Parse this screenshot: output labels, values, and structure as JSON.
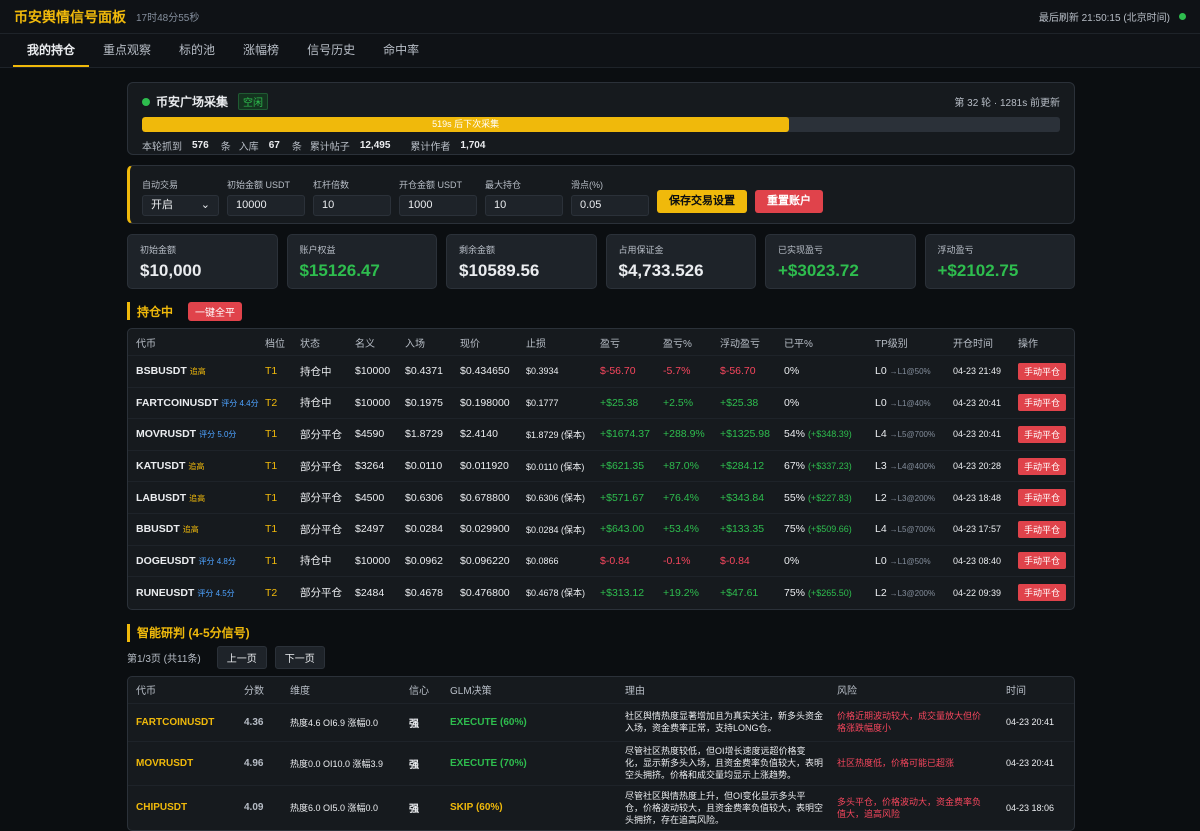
{
  "header": {
    "title": "币安舆情信号面板",
    "uptime": "17时48分55秒",
    "last_refresh": "最后刷新 21:50:15 (北京时间)"
  },
  "nav": {
    "tabs": [
      "我的持仓",
      "重点观察",
      "标的池",
      "涨幅榜",
      "信号历史",
      "命中率"
    ],
    "active": "我的持仓"
  },
  "collector": {
    "title": "币安广场采集",
    "status": "空闲",
    "round_info": "第 32 轮 · 1281s 前更新",
    "progress_text": "519s 后下次采集",
    "progress_fraction": 0.705,
    "stats": [
      {
        "label": "本轮抓到",
        "value": "576",
        "unit": "条"
      },
      {
        "label": "入库",
        "value": "67",
        "unit": "条"
      },
      {
        "label": "累计帖子",
        "value": "12,495",
        "unit": ""
      },
      {
        "label": "累计作者",
        "value": "1,704",
        "unit": ""
      }
    ]
  },
  "settings": {
    "auto_trade_label": "自动交易",
    "auto_trade_value": "开启",
    "initial_label": "初始金额 USDT",
    "initial_value": "10000",
    "leverage_label": "杠杆倍数",
    "leverage_value": "10",
    "open_label": "开仓金额 USDT",
    "open_value": "1000",
    "max_pos_label": "最大持仓",
    "max_pos_value": "10",
    "slippage_label": "滑点(%)",
    "slippage_value": "0.05",
    "save_label": "保存交易设置",
    "reset_label": "重置账户"
  },
  "cards": [
    {
      "label": "初始金额",
      "value": "$10,000",
      "color": "#eaecef"
    },
    {
      "label": "账户权益",
      "value": "$15126.47",
      "color": "#2ebd4e"
    },
    {
      "label": "剩余金额",
      "value": "$10589.56",
      "color": "#eaecef"
    },
    {
      "label": "占用保证金",
      "value": "$4,733.526",
      "color": "#eaecef"
    },
    {
      "label": "已实现盈亏",
      "value": "+$3023.72",
      "color": "#2ebd4e"
    },
    {
      "label": "浮动盈亏",
      "value": "+$2102.75",
      "color": "#2ebd4e"
    }
  ],
  "positions": {
    "title": "持仓中",
    "close_all": "一键全平",
    "headers": [
      "代币",
      "档位",
      "状态",
      "名义",
      "入场",
      "现价",
      "止损",
      "盈亏",
      "盈亏%",
      "浮动盈亏",
      "已平%",
      "TP级别",
      "开仓时间",
      "操作"
    ],
    "rows": [
      {
        "sym": "BSBUSDT",
        "tag": "追高",
        "tag_type": "up",
        "tier": "T1",
        "status": "持仓中",
        "notional": "$10000",
        "entry": "$0.4371",
        "price": "$0.434650",
        "sl": "$0.3934",
        "pnl": "$-56.70",
        "pnl_pct": "-5.7%",
        "float": "$-56.70",
        "closed": "0%",
        "closed_extra": "",
        "sign": "neg",
        "tp": "L0",
        "tp_next": "→L1@50%",
        "time": "04-23 21:49",
        "action": "手动平仓"
      },
      {
        "sym": "FARTCOINUSDT",
        "tag": "评分 4.4分",
        "tag_type": "sc",
        "tier": "T2",
        "status": "持仓中",
        "notional": "$10000",
        "entry": "$0.1975",
        "price": "$0.198000",
        "sl": "$0.1777",
        "pnl": "+$25.38",
        "pnl_pct": "+2.5%",
        "float": "+$25.38",
        "closed": "0%",
        "closed_extra": "",
        "sign": "pos",
        "tp": "L0",
        "tp_next": "→L1@40%",
        "time": "04-23 20:41",
        "action": "手动平仓"
      },
      {
        "sym": "MOVRUSDT",
        "tag": "评分 5.0分",
        "tag_type": "sc",
        "tier": "T1",
        "status": "部分平仓",
        "notional": "$4590",
        "entry": "$1.8729",
        "price": "$2.4140",
        "sl": "$1.8729 (保本)",
        "pnl": "+$1674.37",
        "pnl_pct": "+288.9%",
        "float": "+$1325.98",
        "closed": "54%",
        "closed_extra": "(+$348.39)",
        "sign": "pos",
        "tp": "L4",
        "tp_next": "→L5@700%",
        "time": "04-23 20:41",
        "action": "手动平仓"
      },
      {
        "sym": "KATUSDT",
        "tag": "追高",
        "tag_type": "up",
        "tier": "T1",
        "status": "部分平仓",
        "notional": "$3264",
        "entry": "$0.0110",
        "price": "$0.011920",
        "sl": "$0.0110 (保本)",
        "pnl": "+$621.35",
        "pnl_pct": "+87.0%",
        "float": "+$284.12",
        "closed": "67%",
        "closed_extra": "(+$337.23)",
        "sign": "pos",
        "tp": "L3",
        "tp_next": "→L4@400%",
        "time": "04-23 20:28",
        "action": "手动平仓"
      },
      {
        "sym": "LABUSDT",
        "tag": "追高",
        "tag_type": "up",
        "tier": "T1",
        "status": "部分平仓",
        "notional": "$4500",
        "entry": "$0.6306",
        "price": "$0.678800",
        "sl": "$0.6306 (保本)",
        "pnl": "+$571.67",
        "pnl_pct": "+76.4%",
        "float": "+$343.84",
        "closed": "55%",
        "closed_extra": "(+$227.83)",
        "sign": "pos",
        "tp": "L2",
        "tp_next": "→L3@200%",
        "time": "04-23 18:48",
        "action": "手动平仓"
      },
      {
        "sym": "BBUSDT",
        "tag": "追高",
        "tag_type": "up",
        "tier": "T1",
        "status": "部分平仓",
        "notional": "$2497",
        "entry": "$0.0284",
        "price": "$0.029900",
        "sl": "$0.0284 (保本)",
        "pnl": "+$643.00",
        "pnl_pct": "+53.4%",
        "float": "+$133.35",
        "closed": "75%",
        "closed_extra": "(+$509.66)",
        "sign": "pos",
        "tp": "L4",
        "tp_next": "→L5@700%",
        "time": "04-23 17:57",
        "action": "手动平仓"
      },
      {
        "sym": "DOGEUSDT",
        "tag": "评分 4.8分",
        "tag_type": "sc",
        "tier": "T1",
        "status": "持仓中",
        "notional": "$10000",
        "entry": "$0.0962",
        "price": "$0.096220",
        "sl": "$0.0866",
        "pnl": "$-0.84",
        "pnl_pct": "-0.1%",
        "float": "$-0.84",
        "closed": "0%",
        "closed_extra": "",
        "sign": "neg",
        "tp": "L0",
        "tp_next": "→L1@50%",
        "time": "04-23 08:40",
        "action": "手动平仓"
      },
      {
        "sym": "RUNEUSDT",
        "tag": "评分 4.5分",
        "tag_type": "sc",
        "tier": "T2",
        "status": "部分平仓",
        "notional": "$2484",
        "entry": "$0.4678",
        "price": "$0.476800",
        "sl": "$0.4678 (保本)",
        "pnl": "+$313.12",
        "pnl_pct": "+19.2%",
        "float": "+$47.61",
        "closed": "75%",
        "closed_extra": "(+$265.50)",
        "sign": "pos",
        "tp": "L2",
        "tp_next": "→L3@200%",
        "time": "04-22 09:39",
        "action": "手动平仓"
      }
    ]
  },
  "research": {
    "title": "智能研判 (4-5分信号)",
    "page_info": "第1/3页 (共11条)",
    "prev": "上一页",
    "next": "下一页",
    "headers": [
      "代币",
      "分数",
      "维度",
      "信心",
      "GLM决策",
      "理由",
      "风险",
      "时间"
    ],
    "rows": [
      {
        "sym": "FARTCOINUSDT",
        "score": "4.36",
        "dims": "热度4.6 OI6.9 涨幅0.0",
        "conf": "强",
        "decision": "EXECUTE (60%)",
        "decision_color": "#2ebd4e",
        "reason": "社区舆情热度显著增加且为真实关注，新多头资金入场，资金费率正常，支持LONG仓。",
        "risk": "价格近期波动较大，成交量放大但价格涨跌幅度小",
        "time": "04-23 20:41"
      },
      {
        "sym": "MOVRUSDT",
        "score": "4.96",
        "dims": "热度0.0 OI10.0 涨幅3.9",
        "conf": "强",
        "decision": "EXECUTE (70%)",
        "decision_color": "#2ebd4e",
        "reason": "尽管社区热度较低，但OI增长速度远超价格变化，显示新多头入场，且资金费率负值较大，表明空头拥挤。价格和成交量均显示上涨趋势。",
        "risk": "社区热度低，价格可能已超涨",
        "time": "04-23 20:41"
      },
      {
        "sym": "CHIPUSDT",
        "score": "4.09",
        "dims": "热度6.0 OI5.0 涨幅0.0",
        "conf": "强",
        "decision": "SKIP (60%)",
        "decision_color": "#f0b90b",
        "reason": "尽管社区舆情热度上升，但OI变化显示多头平仓，价格波动较大，且资金费率负值较大，表明空头拥挤，存在追高风险。",
        "risk": "多头平仓，价格波动大，资金费率负值大，追高风险",
        "time": "04-23 18:06"
      }
    ]
  }
}
